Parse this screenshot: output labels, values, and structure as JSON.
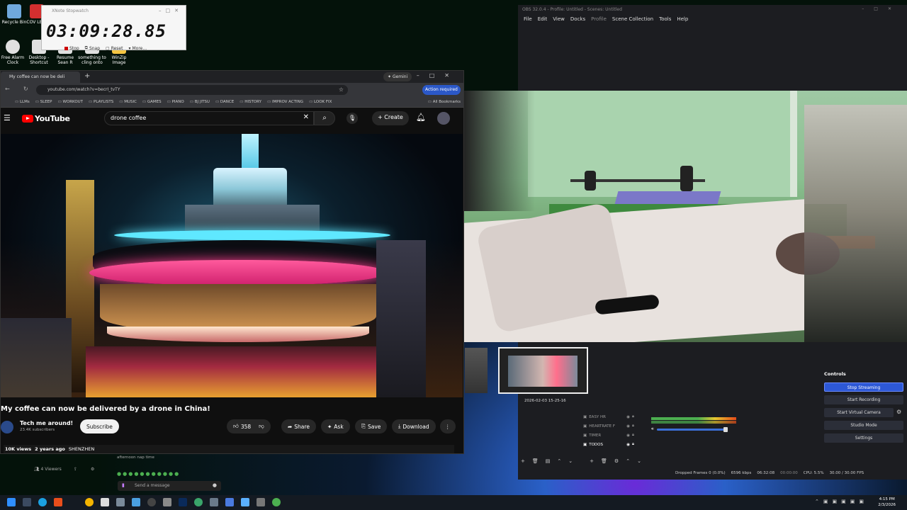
{
  "desktop": {
    "icons": [
      {
        "label": "Recycle Bin",
        "color": "#6fa8dc"
      },
      {
        "label": "COV LETT",
        "color": "#d32f2f"
      },
      {
        "label": "Free Alarm Clock",
        "color": "#e0e0e0"
      },
      {
        "label": "Desktop - Shortcut",
        "color": "#e0e0e0"
      },
      {
        "label": "Resume Sean R",
        "color": "#e0e0e0"
      },
      {
        "label": "something to cling onto",
        "color": "#e0e0e0"
      },
      {
        "label": "WinZip Image",
        "color": "#f4c542"
      }
    ]
  },
  "stopwatch": {
    "title": "XNote Stopwatch",
    "time": "03:09:28.85",
    "buttons": [
      "Stop",
      "Snap",
      "Reset",
      "More..."
    ]
  },
  "browser": {
    "tab_title": "My coffee can now be deli",
    "gemini_label": "Gemini",
    "url": "youtube.com/watch?v=becrI_tvTY",
    "action_label": "Action required",
    "bookmarks": [
      "LLMs",
      "SLEEP",
      "WORKOUT",
      "PLAYLISTS",
      "MUSIC",
      "GAMES",
      "PIANO",
      "BJ JITSU",
      "DANCE",
      "HISTORY",
      "IMPROV ACTING",
      "LOOK FIX"
    ],
    "all_bookmarks": "All Bookmarks"
  },
  "youtube": {
    "logo": "YouTube",
    "search_query": "drone coffee",
    "create_label": "Create",
    "video_title": "My coffee can now be delivered by a drone in China!",
    "channel_name": "Tech me around!",
    "subscribers": "23.4K subscribers",
    "subscribe_label": "Subscribe",
    "likes": "358",
    "share_label": "Share",
    "ask_label": "Ask",
    "save_label": "Save",
    "download_label": "Download",
    "views": "10K views",
    "age": "2 years ago",
    "location": "SHENZHEN"
  },
  "obs": {
    "title": "OBS 32.0.4 - Profile: Untitled - Scenes: Untitled",
    "menu": [
      "File",
      "Edit",
      "View",
      "Docks",
      "Profile",
      "Scene Collection",
      "Tools",
      "Help"
    ],
    "sources": [
      "EASY HR",
      "HEARTRATE F",
      "TIMER",
      "TODOS"
    ],
    "thumbnail_date": "2026-02-03 15-25-16",
    "controls_title": "Controls",
    "controls": [
      "Stop Streaming",
      "Start Recording",
      "Start Virtual Camera",
      "Studio Mode",
      "Settings"
    ],
    "status": {
      "dropped": "Dropped Frames 0 (0.0%)",
      "kbps": "6596 kbps",
      "stream_time": "06:32:08",
      "rec_time": "00:00:00",
      "cpu": "CPU: 5.5%",
      "fps": "30.00 / 30.00 FPS"
    }
  },
  "chat": {
    "viewers": "4 Viewers",
    "status_text": "afternoon nap time",
    "send_placeholder": "Send a message"
  },
  "taskbar": {
    "time": "4:15 PM",
    "date": "2/3/2026"
  }
}
